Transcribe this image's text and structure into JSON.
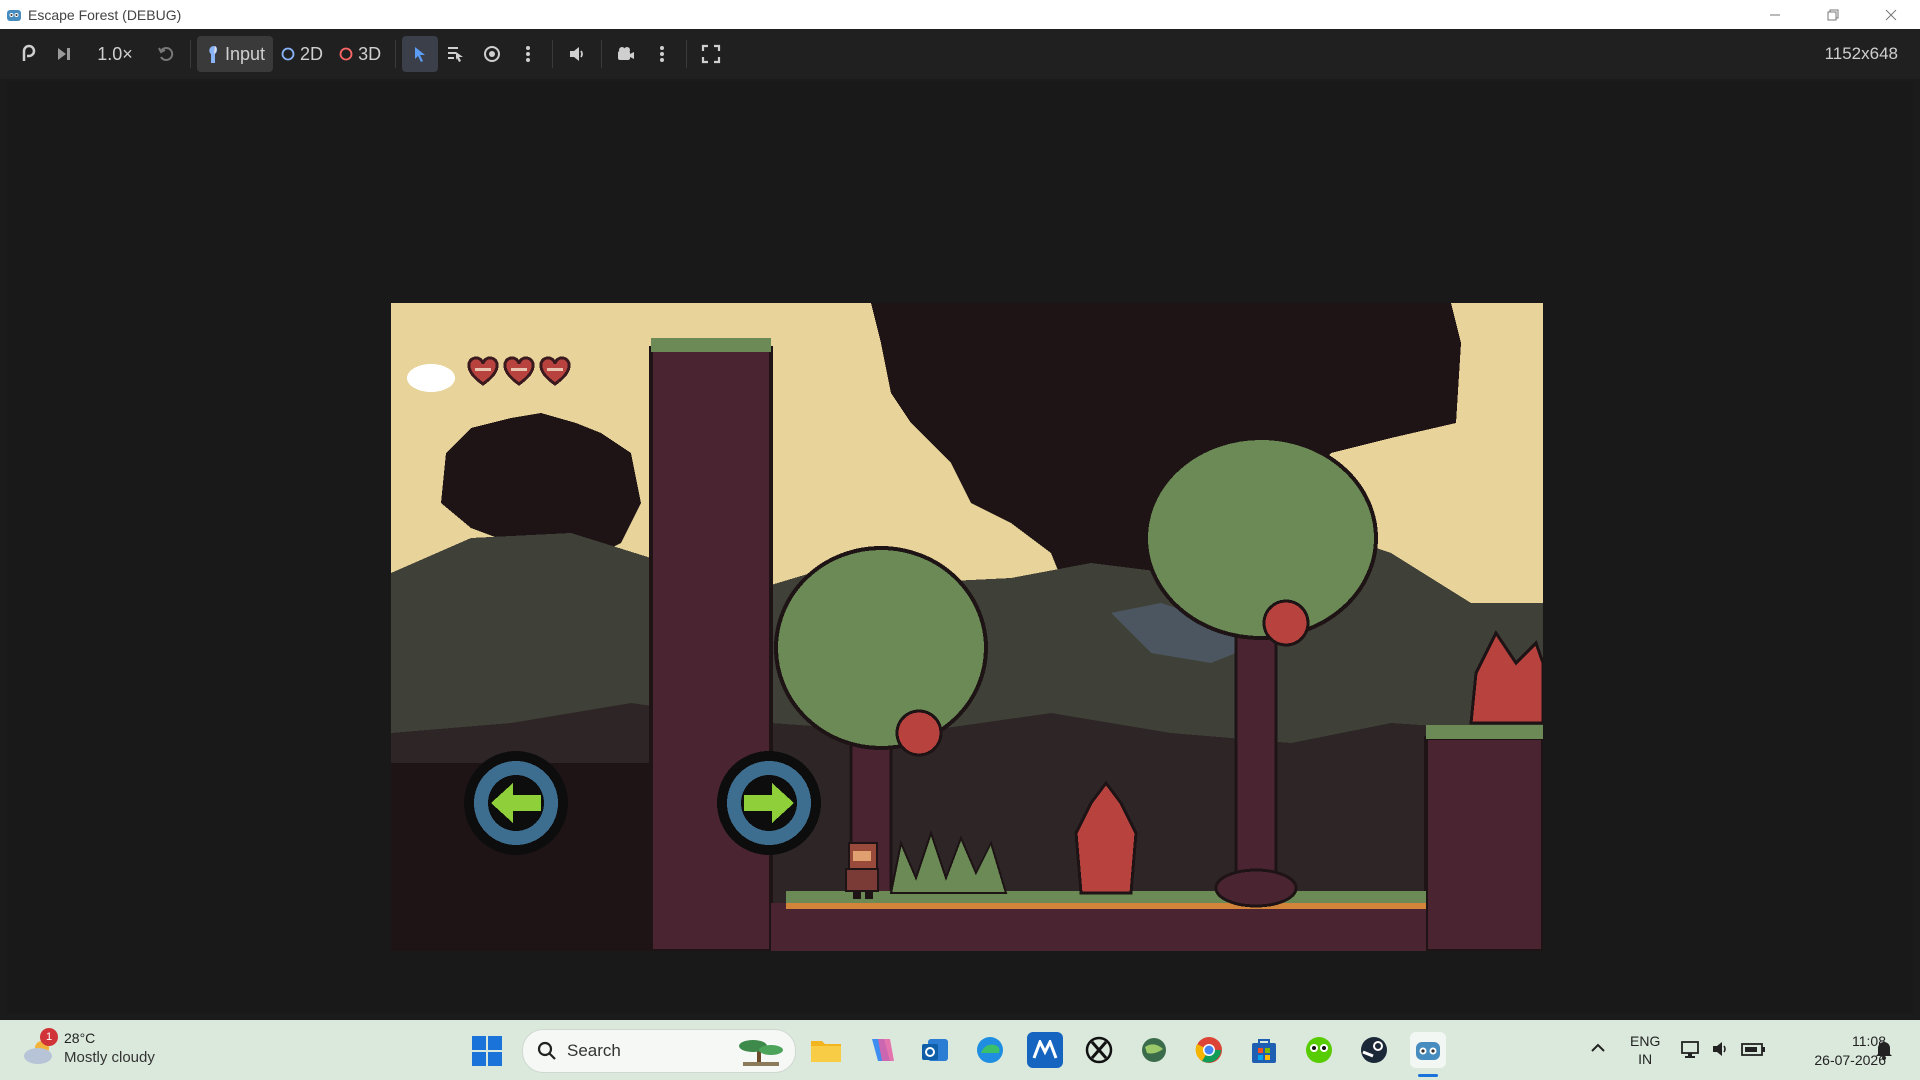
{
  "window": {
    "title": "Escape Forest (DEBUG)"
  },
  "toolbar": {
    "speed": "1.0×",
    "input_label": "Input",
    "mode_2d": "2D",
    "mode_3d": "3D",
    "resolution": "1152x648"
  },
  "game": {
    "hearts": 3,
    "colors": {
      "sky": "#e8d49a",
      "foliage": "#6b8a55",
      "dark": "#1e1416",
      "trunk": "#4a2431",
      "hills": "#3f4038",
      "red_plant": "#b8423d",
      "button_ring": "#3d6e8f",
      "button_center": "#8fcf3a"
    }
  },
  "taskbar": {
    "weather": {
      "badge": "1",
      "temp": "28°C",
      "condition": "Mostly cloudy"
    },
    "search_placeholder": "Search",
    "lang_line1": "ENG",
    "lang_line2": "IN",
    "time": "11:08",
    "date": "26-07-2026"
  }
}
